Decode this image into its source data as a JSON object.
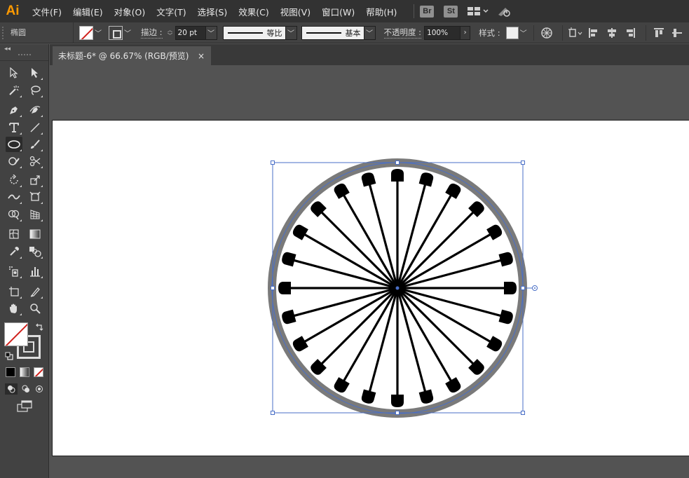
{
  "app": {
    "logo": "Ai"
  },
  "menubar": {
    "items": [
      "文件(F)",
      "编辑(E)",
      "对象(O)",
      "文字(T)",
      "选择(S)",
      "效果(C)",
      "视图(V)",
      "窗口(W)",
      "帮助(H)"
    ],
    "bridge": "Br",
    "stock": "St"
  },
  "controlbar": {
    "object_type": "椭圆",
    "stroke_label": "描边 :",
    "stroke_width": "20 pt",
    "variable_width_profile": "等比",
    "brush_definition": "基本",
    "opacity_label": "不透明度 :",
    "opacity_value": "100%",
    "style_label": "样式 :"
  },
  "document": {
    "tab_title": "未标题-6* @ 66.67% (RGB/预览)",
    "close_glyph": "×"
  },
  "artwork": {
    "spoke_count": 24,
    "rim_color": "#7a7a7a",
    "spoke_color": "#000000",
    "selection_color": "#4a6fc7",
    "artboard_color": "#ffffff"
  },
  "colors": {
    "menubar_bg": "#323232",
    "panel_bg": "#424242",
    "canvas_bg": "#535353",
    "accent": "#ff9a00",
    "none_slash": "#d0211c"
  }
}
